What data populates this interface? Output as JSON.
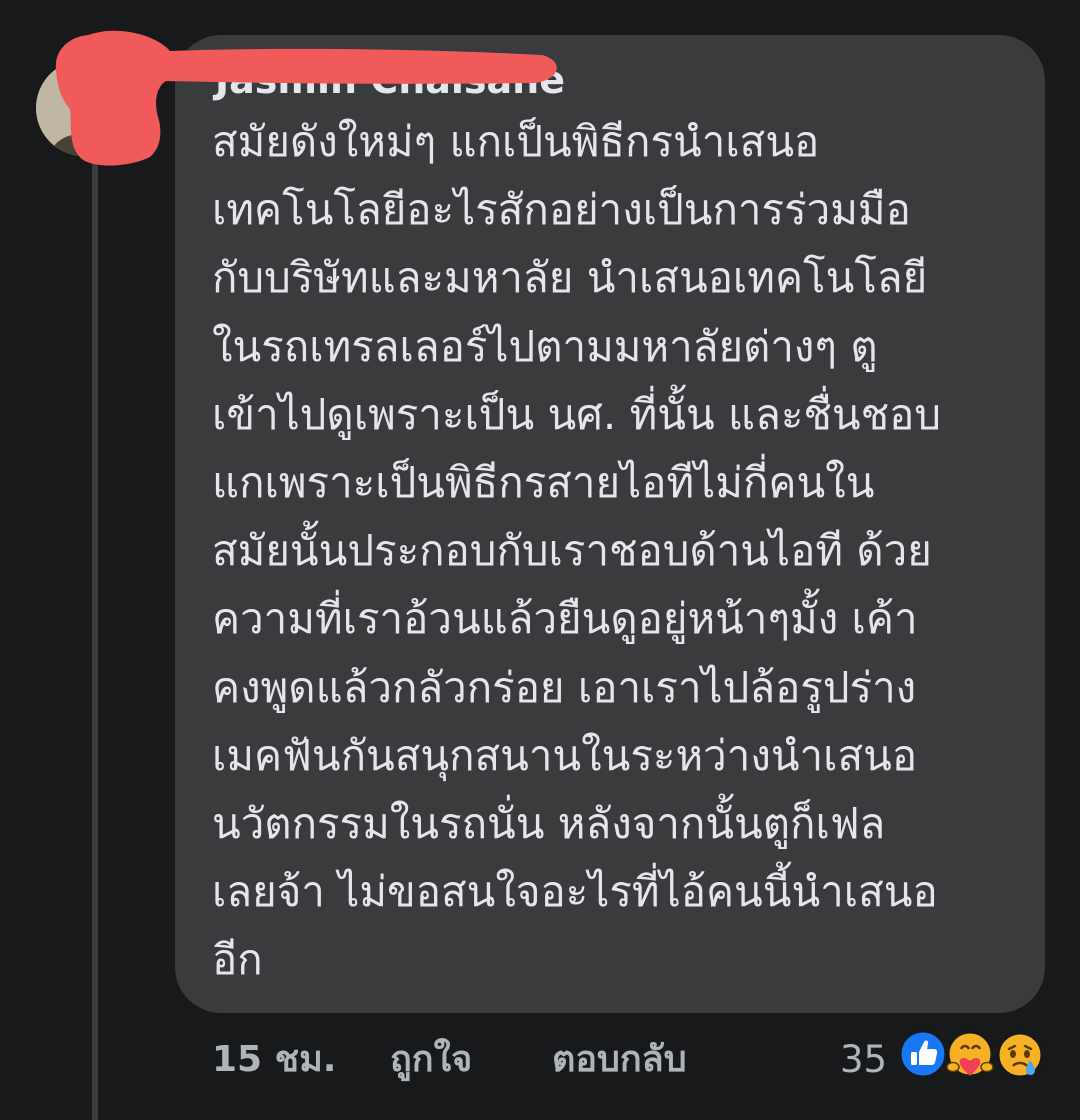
{
  "comment": {
    "author": "Jasmin Chaisane",
    "lines": [
      "สมัยดังใหม่ๆ แกเป็นพิธีกรนำเสนอ",
      "เทคโนโลยีอะไรสักอย่างเป็นการร่วมมือ",
      "กับบริษัทและมหาลัย นำเสนอเทคโนโลยี",
      "ในรถเทรลเลอร์ไปตามมหาลัยต่างๆ ตู",
      "เข้าไปดูเพราะเป็น นศ. ที่นั้น และชื่นชอบ",
      "แกเพราะเป็นพิธีกรสายไอทีไม่กี่คนใน",
      "สมัยนั้นประกอบกับเราชอบด้านไอที ด้วย",
      "ความที่เราอ้วนแล้วยืนดูอยู่หน้าๆมั้ง เค้า",
      "คงพูดแล้วกลัวกร่อย เอาเราไปล้อรูปร่าง",
      "เมคฟันกันสนุกสนานในระหว่างนำเสนอ",
      "นวัตกรรมในรถนั่น หลังจากนั้นตูก็เฟล",
      "เลยจ้า ไม่ขอสนใจอะไรที่ไอ้คนนี้นำเสนอ",
      "อีก"
    ]
  },
  "actions": {
    "time": "15 ชม.",
    "like_label": "ถูกใจ",
    "reply_label": "ตอบกลับ"
  },
  "reactions": {
    "count": "35",
    "icons": [
      "like-icon",
      "care-icon",
      "sad-icon"
    ]
  },
  "colors": {
    "background": "#18191a",
    "bubble": "#3a3b3c",
    "text_primary": "#e4e6eb",
    "text_secondary": "#b0b3b8",
    "like_blue": "#1877f2",
    "redaction_red": "#f05a5a"
  }
}
